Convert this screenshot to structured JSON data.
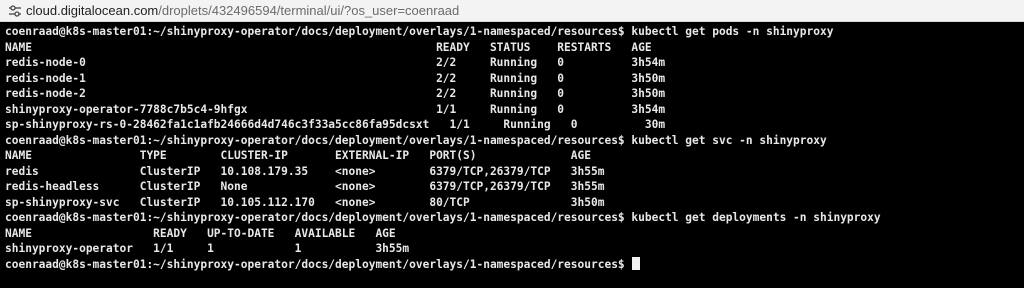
{
  "browser": {
    "url_host": "cloud.digitalocean.com",
    "url_path": "/droplets/432496594/terminal/ui/?os_user=coenraad"
  },
  "terminal": {
    "lines": [
      "coenraad@k8s-master01:~/shinyproxy-operator/docs/deployment/overlays/1-namespaced/resources$ kubectl get pods -n shinyproxy",
      "NAME                                                            READY   STATUS    RESTARTS   AGE",
      "redis-node-0                                                    2/2     Running   0          3h54m",
      "redis-node-1                                                    2/2     Running   0          3h50m",
      "redis-node-2                                                    2/2     Running   0          3h50m",
      "shinyproxy-operator-7788c7b5c4-9hfgx                            1/1     Running   0          3h54m",
      "sp-shinyproxy-rs-0-28462fa1c1afb24666d4d746c3f33a5cc86fa95dcsxt   1/1     Running   0          30m",
      "coenraad@k8s-master01:~/shinyproxy-operator/docs/deployment/overlays/1-namespaced/resources$ kubectl get svc -n shinyproxy",
      "NAME                TYPE        CLUSTER-IP       EXTERNAL-IP   PORT(S)              AGE",
      "redis               ClusterIP   10.108.179.35    <none>        6379/TCP,26379/TCP   3h55m",
      "redis-headless      ClusterIP   None             <none>        6379/TCP,26379/TCP   3h55m",
      "sp-shinyproxy-svc   ClusterIP   10.105.112.170   <none>        80/TCP               3h50m",
      "coenraad@k8s-master01:~/shinyproxy-operator/docs/deployment/overlays/1-namespaced/resources$ kubectl get deployments -n shinyproxy",
      "NAME                  READY   UP-TO-DATE   AVAILABLE   AGE",
      "shinyproxy-operator   1/1     1            1           3h55m",
      "coenraad@k8s-master01:~/shinyproxy-operator/docs/deployment/overlays/1-namespaced/resources$ "
    ]
  },
  "colors": {
    "terminal_bg": "#000000",
    "terminal_fg": "#e8e8e8",
    "urlbar_bg": "#f3f3f3"
  },
  "icons": {
    "site": "tune-icon"
  }
}
